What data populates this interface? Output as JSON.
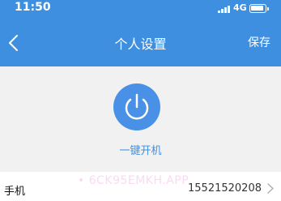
{
  "status_bar": {
    "time": "11:50",
    "network": "4G",
    "signal_icon": "signal-bars-icon",
    "battery_icon": "battery-icon"
  },
  "nav": {
    "back_icon": "chevron-left-icon",
    "title": "个人设置",
    "save_label": "保存"
  },
  "power": {
    "icon": "power-icon",
    "label": "一键开机"
  },
  "phone_row": {
    "label": "手机",
    "value": "15521520208",
    "chevron_icon": "chevron-right-icon"
  },
  "watermark": {
    "text": "• 6CK95EMKH.APP"
  },
  "colors": {
    "primary": "#3f8fe0",
    "power_button": "#4891e6",
    "content_background": "#f1f1f1"
  }
}
